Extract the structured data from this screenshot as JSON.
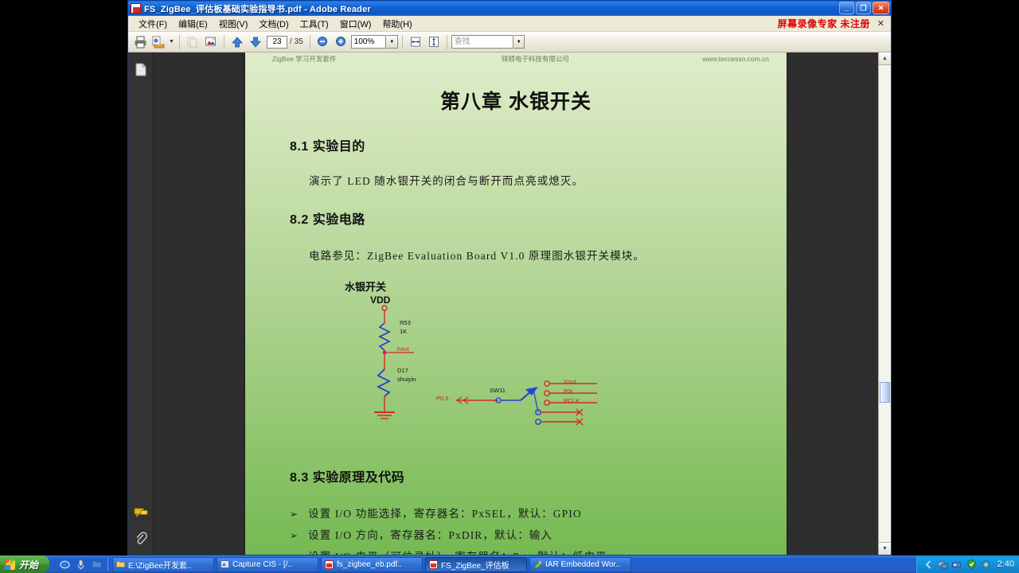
{
  "window": {
    "title": "FS_ZigBee_评估板基础实验指导书.pdf - Adobe Reader",
    "minimize_label": "_",
    "restore_label": "❐",
    "close_label": "✕"
  },
  "menubar": {
    "items": [
      {
        "label": "文件(F)"
      },
      {
        "label": "编辑(E)"
      },
      {
        "label": "视图(V)"
      },
      {
        "label": "文档(D)"
      },
      {
        "label": "工具(T)"
      },
      {
        "label": "窗口(W)"
      },
      {
        "label": "帮助(H)"
      }
    ],
    "banner": "屏幕录像专家  未注册",
    "banner_close": "✕",
    "banner_color": "#e00000"
  },
  "toolbar": {
    "print_icon": "printer-icon",
    "email_icon": "email-document-icon",
    "copy_icon": "copy-icon",
    "snapshot_icon": "snapshot-icon",
    "prev_icon": "previous-page-icon",
    "next_icon": "next-page-icon",
    "page_value": "23",
    "page_total": "/ 35",
    "zoom_out_icon": "zoom-out-icon",
    "zoom_in_icon": "zoom-in-icon",
    "zoom_value": "100%",
    "zoom_caret": "▼",
    "fit_width_icon": "fit-width-icon",
    "fit_page_icon": "fit-page-icon",
    "find_placeholder": "查找",
    "find_caret": "▼",
    "dropdown_caret": "▼"
  },
  "navpane": {
    "pages_icon": "pages-panel-icon",
    "comments_icon": "comments-panel-icon",
    "attachments_icon": "attachments-panel-icon"
  },
  "document": {
    "header_left": "ZigBee 学习开发套件",
    "header_center": "铎顺电子科技有限公司",
    "header_right": "www.teccesso.com.cn",
    "title": "第八章  水银开关",
    "sections": [
      {
        "heading": "8.1  实验目的",
        "paragraph": "演示了 LED 随水银开关的闭合与断开而点亮或熄灭。"
      },
      {
        "heading": "8.2  实验电路",
        "paragraph": "电路参见：ZigBee Evaluation Board V1.0 原理图水银开关模块。"
      },
      {
        "heading": "8.3  实验原理及代码",
        "bullets": [
          "设置 I/O 功能选择，寄存器名：PxSEL，默认：GPIO",
          "设置 I/O 方向，寄存器名：PxDIR，默认：输入",
          "设置 I/O 电平（可位寻址），寄存器名：Px，默认：低电平"
        ],
        "bullet_marker": "➢"
      }
    ],
    "circuit": {
      "caption": "水银开关",
      "labels": {
        "vdd": "VDD",
        "r53": "R53",
        "r53_value": "1K",
        "net_xout": "Xout",
        "d17": "D17",
        "d17_value": "shuiyin",
        "sw11": "SW11",
        "port": "P0.6",
        "pin1": "Xout",
        "pin2": "P0r",
        "pin3": "RCLK"
      },
      "wire_color": "#d42b1e",
      "part_color": "#2040cc",
      "net_color": "#d42b1e"
    }
  },
  "scrollbar": {
    "up_arrow": "▲",
    "down_arrow": "▼"
  },
  "taskbar": {
    "start_label": "开始",
    "quick_launch": [
      {
        "name": "ie-icon"
      },
      {
        "name": "media-player-icon"
      },
      {
        "name": "folder-icon"
      }
    ],
    "tasks": [
      {
        "label": "E:\\ZigBee开发套..",
        "icon": "folder-icon",
        "active": false
      },
      {
        "label": "Capture CIS - [/..",
        "icon": "capture-icon",
        "active": false
      },
      {
        "label": "fs_zigbee_eb.pdf..",
        "icon": "pdf-icon",
        "active": false
      },
      {
        "label": "FS_ZigBee_评估板",
        "icon": "pdf-icon",
        "active": true
      },
      {
        "label": "IAR Embedded Wor..",
        "icon": "iar-icon",
        "active": false
      }
    ],
    "tray_icons": [
      "show-desktop-icon",
      "network-icon",
      "usb-icon",
      "shield-icon",
      "antivirus-icon"
    ],
    "clock": "2:40"
  }
}
